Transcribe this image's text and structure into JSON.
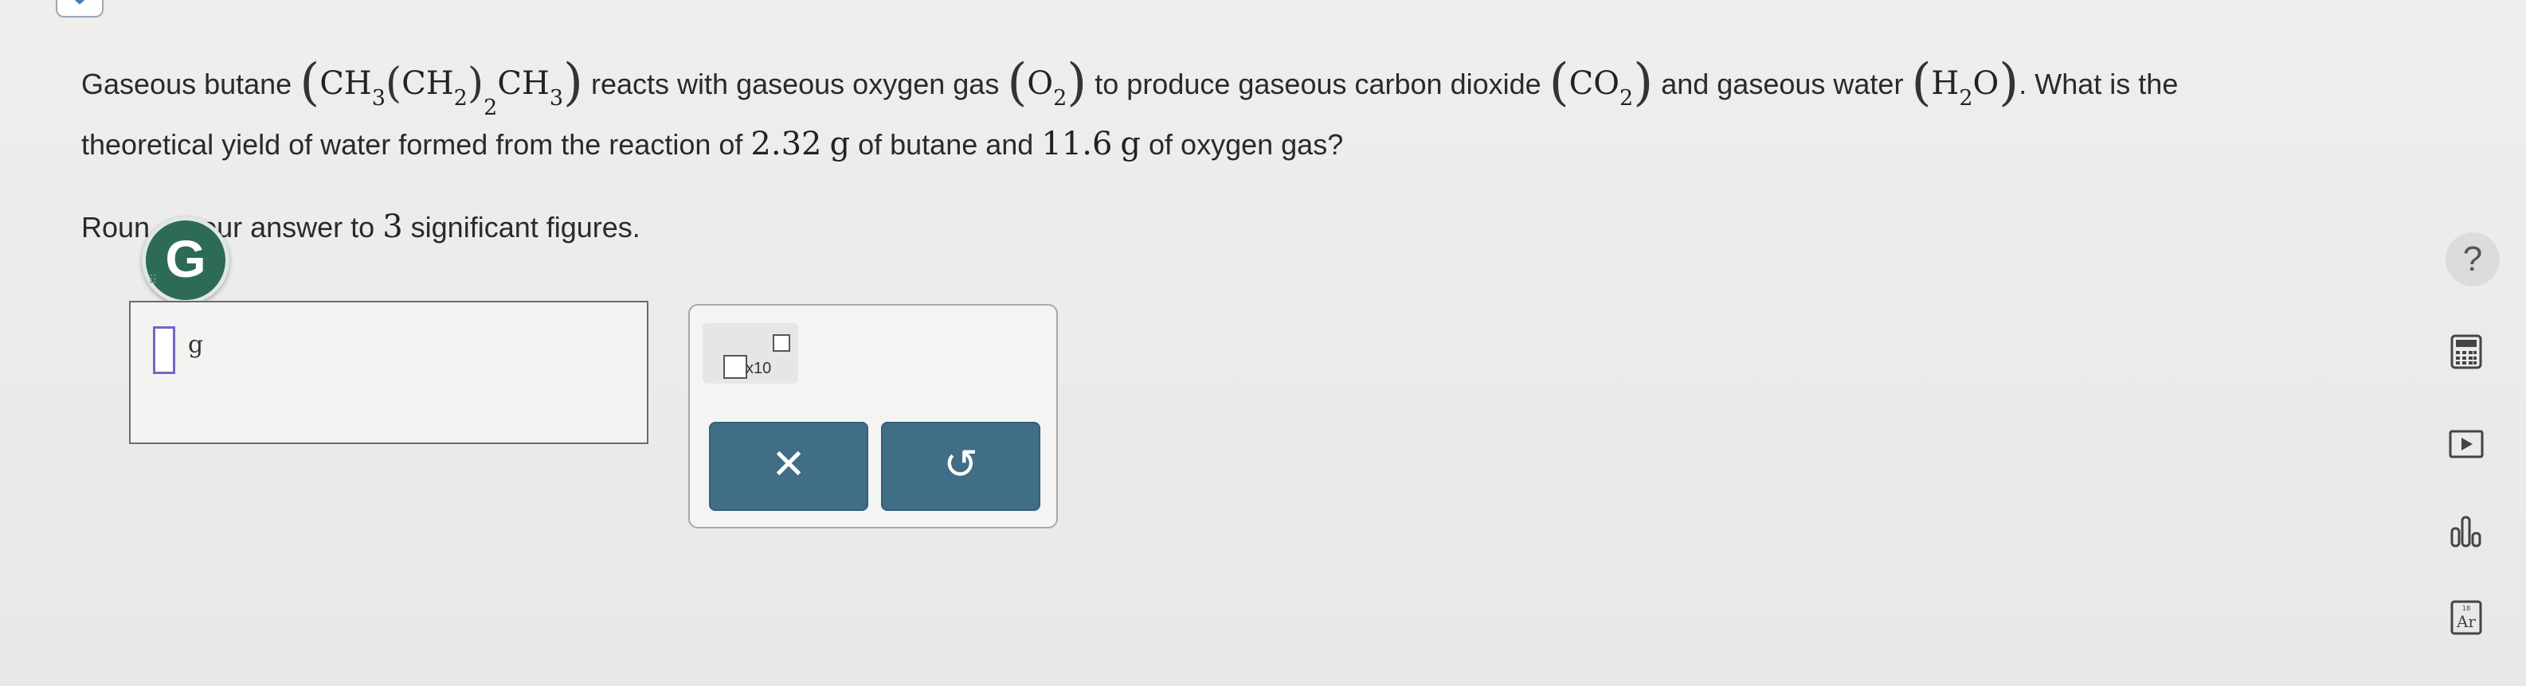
{
  "question": {
    "t1": "Gaseous butane",
    "butane_formula": {
      "a": "CH",
      "s1": "3",
      "b": "CH",
      "s2": "2",
      "s3": "2",
      "c": "CH",
      "s4": "3"
    },
    "t2": "reacts with gaseous oxygen gas",
    "oxygen_formula": {
      "a": "O",
      "s": "2"
    },
    "t3": "to produce gaseous carbon dioxide",
    "co2_formula": {
      "a": "CO",
      "s": "2"
    },
    "t4": "and gaseous water",
    "water_formula": {
      "a": "H",
      "s": "2",
      "b": "O"
    },
    "t5": ". What is the",
    "line2_a": "theoretical yield of water formed from the reaction of",
    "butane_mass": "2.32",
    "unit_g": "g",
    "line2_b": "of butane and",
    "oxygen_mass": "11.6",
    "line2_c": "of oxygen gas?",
    "round_a": "Roun",
    "round_b": "our answer to",
    "sig_figs": "3",
    "round_c": "significant figures."
  },
  "badge": {
    "letter": "G"
  },
  "answer": {
    "value": "",
    "unit": "g"
  },
  "tools": {
    "sci_label": "x10",
    "clear_symbol": "✕",
    "undo_symbol": "↺"
  },
  "rail": {
    "help_symbol": "?"
  }
}
